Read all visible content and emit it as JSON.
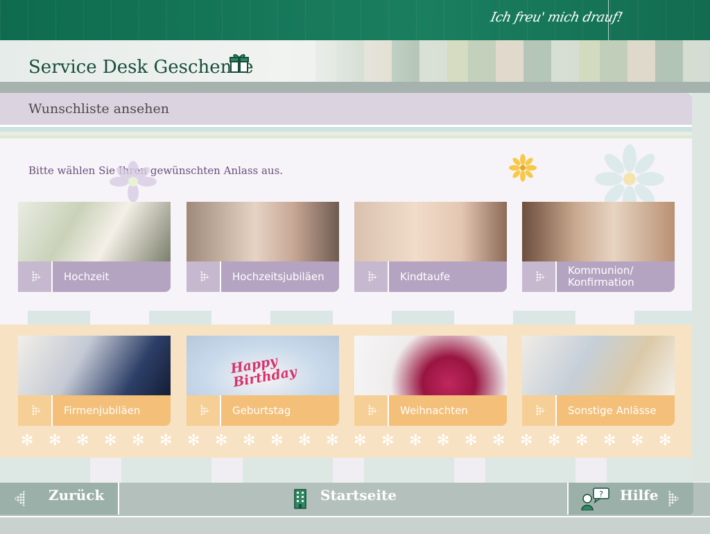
{
  "top_bar": {
    "slogan": "Ich freu' mich drauf!"
  },
  "header": {
    "title": "Service Desk Geschenke",
    "icon": "gift-icon"
  },
  "section": {
    "title": "Wunschliste ansehen"
  },
  "main": {
    "prompt": "Bitte wählen Sie Ihren gewünschten Anlass aus.",
    "occasions_row1": [
      {
        "label": "Hochzeit",
        "photo": "wedding-photo"
      },
      {
        "label": "Hochzeitsjubiläen",
        "photo": "elderly-couple-photo"
      },
      {
        "label": "Kindtaufe",
        "photo": "mother-baby-photo"
      },
      {
        "label_line1": "Kommunion/",
        "label_line2": "Konfirmation",
        "photo": "two-girls-photo"
      }
    ],
    "occasions_row2": [
      {
        "label": "Firmenjubiläen",
        "photo": "champagne-toast-photo"
      },
      {
        "label": "Geburtstag",
        "photo": "birthday-cake-photo",
        "cake_text_line1": "Happy",
        "cake_text_line2": "Birthday"
      },
      {
        "label": "Weihnachten",
        "photo": "christmas-ornament-photo"
      },
      {
        "label": "Sonstige Anlässe",
        "photo": "celebration-photo"
      }
    ]
  },
  "footer": {
    "back_label": "Zurück",
    "home_label": "Startseite",
    "help_label": "Hilfe"
  },
  "colors": {
    "brand_green": "#0f6b4e",
    "title_green": "#174d3b",
    "lavender": "#b4a4c1",
    "orange": "#f3bf79"
  }
}
